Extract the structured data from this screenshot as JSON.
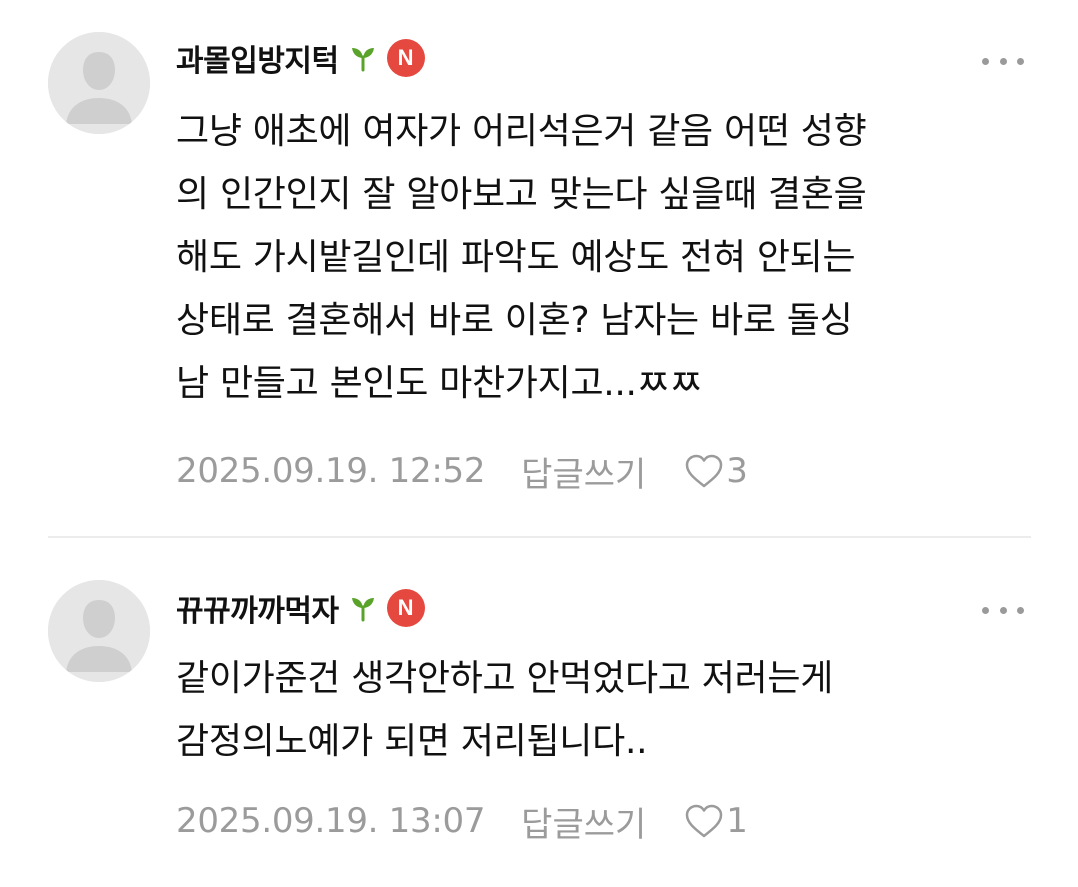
{
  "comments": [
    {
      "author": "과몰입방지턱",
      "badge_letter": "N",
      "lines": [
        "그냥 애초에 여자가 어리석은거 같음 어떤 성향",
        "의 인간인지 잘 알아보고 맞는다 싶을때 결혼을",
        "해도 가시밭길인데 파악도 예상도 전혀 안되는",
        "상태로 결혼해서 바로 이혼? 남자는 바로 돌싱",
        "남 만들고 본인도 마찬가지고...ㅉㅉ"
      ],
      "timestamp": "2025.09.19. 12:52",
      "reply_label": "답글쓰기",
      "like_count": "3"
    },
    {
      "author": "뀨뀨까까먹자",
      "badge_letter": "N",
      "lines": [
        "같이가준건 생각안하고 안먹었다고 저러는게",
        "감정의노예가 되면 저리됩니다.."
      ],
      "timestamp": "2025.09.19. 13:07",
      "reply_label": "답글쓰기",
      "like_count": "1"
    }
  ],
  "icons": {
    "avatar": "default-avatar-icon",
    "level": "sprout-icon",
    "badge": "new-badge-icon",
    "menu": "more-options-icon",
    "like": "heart-outline-icon"
  },
  "colors": {
    "badge": "#e5483f",
    "sprout": "#5aa32b",
    "meta_text": "#9b9b9b",
    "avatar_bg": "#e6e6e6",
    "avatar_fg": "#cfcfcf",
    "divider": "#ececec"
  }
}
